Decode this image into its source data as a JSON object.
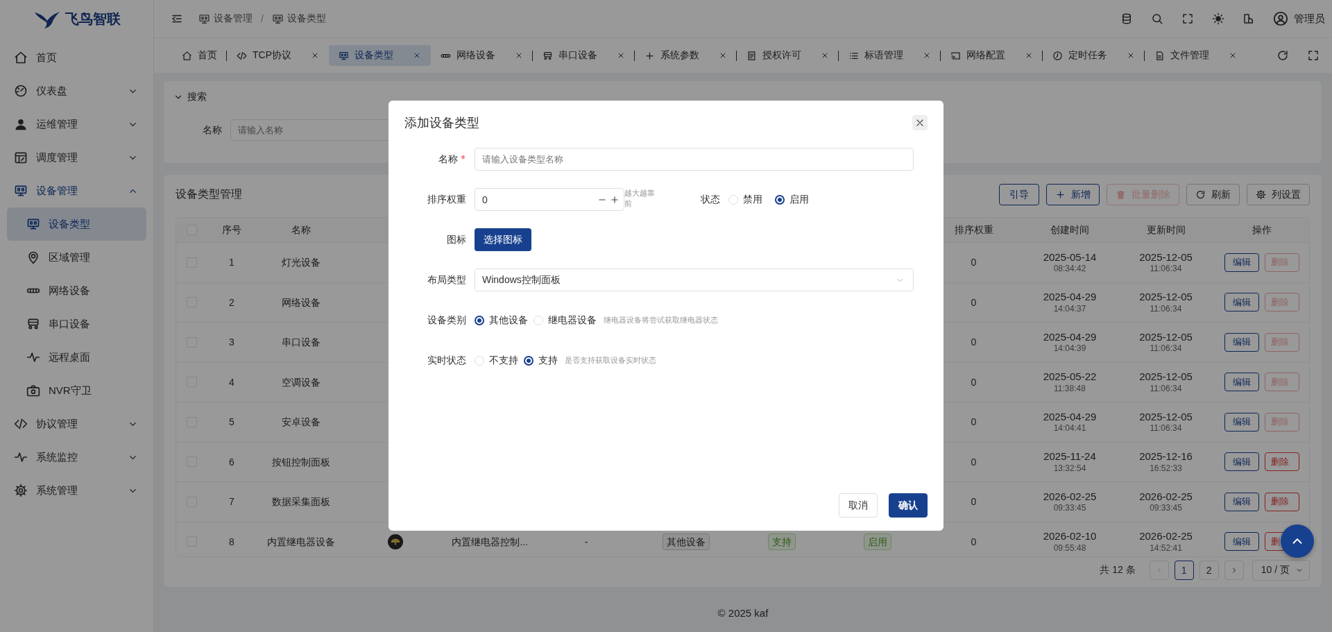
{
  "sidebar": {
    "logo": "飞鸟智联",
    "items": [
      {
        "label": "首页",
        "kind": "link",
        "selected": false
      },
      {
        "label": "仪表盘",
        "kind": "group",
        "expanded": false,
        "selected": false
      },
      {
        "label": "运维管理",
        "kind": "group",
        "expanded": false,
        "selected": false
      },
      {
        "label": "调度管理",
        "kind": "group",
        "expanded": false,
        "selected": false
      },
      {
        "label": "设备管理",
        "kind": "group",
        "expanded": true,
        "selected": true,
        "children": [
          {
            "label": "设备类型",
            "selected": true
          },
          {
            "label": "区域管理",
            "selected": false
          },
          {
            "label": "网络设备",
            "selected": false
          },
          {
            "label": "串口设备",
            "selected": false
          },
          {
            "label": "远程桌面",
            "selected": false
          },
          {
            "label": "NVR守卫",
            "selected": false
          }
        ]
      },
      {
        "label": "协议管理",
        "kind": "group",
        "expanded": false,
        "selected": false
      },
      {
        "label": "系统监控",
        "kind": "group",
        "expanded": false,
        "selected": false
      },
      {
        "label": "系统管理",
        "kind": "group",
        "expanded": false,
        "selected": false
      }
    ]
  },
  "header": {
    "breadcrumb": {
      "separator": "/",
      "items": [
        "设备管理",
        "设备类型"
      ]
    },
    "user": "管理员"
  },
  "tabs": [
    {
      "label": "首页",
      "selected": false,
      "closable": false
    },
    {
      "label": "TCP协议",
      "selected": false,
      "closable": true
    },
    {
      "label": "设备类型",
      "selected": true,
      "closable": true
    },
    {
      "label": "网络设备",
      "selected": false,
      "closable": true
    },
    {
      "label": "串口设备",
      "selected": false,
      "closable": true
    },
    {
      "label": "系统参数",
      "selected": false,
      "closable": true
    },
    {
      "label": "授权许可",
      "selected": false,
      "closable": true
    },
    {
      "label": "标语管理",
      "selected": false,
      "closable": true
    },
    {
      "label": "网络配置",
      "selected": false,
      "closable": true
    },
    {
      "label": "定时任务",
      "selected": false,
      "closable": true
    },
    {
      "label": "文件管理",
      "selected": false,
      "closable": true
    }
  ],
  "search": {
    "title": "搜索",
    "expanded": true,
    "fields": [
      {
        "label": "名称",
        "placeholder": "请输入名称"
      }
    ]
  },
  "table_panel": {
    "title": "设备类型管理",
    "toolbar": [
      {
        "label": "引导",
        "kind": "guide",
        "disabled": false
      },
      {
        "label": "新增",
        "kind": "add",
        "disabled": false
      },
      {
        "label": "批量删除",
        "kind": "delete",
        "disabled": true
      },
      {
        "label": "刷新",
        "kind": "refresh",
        "disabled": false
      },
      {
        "label": "列设置",
        "kind": "settings",
        "disabled": false
      }
    ],
    "header_checked": false,
    "columns": [
      "序号",
      "名称",
      "排序权重",
      "创建时间",
      "更新时间",
      "操作"
    ],
    "rows": [
      {
        "checked": false,
        "index": "1",
        "name": "灯光设备",
        "weight": "0",
        "created": [
          "2025-05-14",
          "08:34:42"
        ],
        "updated": [
          "2025-12-05",
          "11:06:34"
        ],
        "actions": [
          {
            "label": "编辑",
            "kind": "edit",
            "disabled": false
          },
          {
            "label": "删除",
            "kind": "delete",
            "disabled": true
          }
        ]
      },
      {
        "checked": false,
        "index": "2",
        "name": "网络设备",
        "weight": "0",
        "created": [
          "2025-04-29",
          "14:04:37"
        ],
        "updated": [
          "2025-12-05",
          "11:06:34"
        ],
        "actions": [
          {
            "label": "编辑",
            "kind": "edit",
            "disabled": false
          },
          {
            "label": "删除",
            "kind": "delete",
            "disabled": true
          }
        ]
      },
      {
        "checked": false,
        "index": "3",
        "name": "串口设备",
        "weight": "0",
        "created": [
          "2025-04-29",
          "14:04:39"
        ],
        "updated": [
          "2025-12-05",
          "11:06:34"
        ],
        "actions": [
          {
            "label": "编辑",
            "kind": "edit",
            "disabled": false
          },
          {
            "label": "删除",
            "kind": "delete",
            "disabled": true
          }
        ]
      },
      {
        "checked": false,
        "index": "4",
        "name": "空调设备",
        "weight": "0",
        "created": [
          "2025-05-22",
          "11:38:48"
        ],
        "updated": [
          "2025-12-05",
          "11:06:34"
        ],
        "actions": [
          {
            "label": "编辑",
            "kind": "edit",
            "disabled": false
          },
          {
            "label": "删除",
            "kind": "delete",
            "disabled": true
          }
        ]
      },
      {
        "checked": false,
        "index": "5",
        "name": "安卓设备",
        "weight": "0",
        "created": [
          "2025-04-29",
          "14:04:41"
        ],
        "updated": [
          "2025-12-05",
          "11:06:34"
        ],
        "actions": [
          {
            "label": "编辑",
            "kind": "edit",
            "disabled": false
          },
          {
            "label": "删除",
            "kind": "delete",
            "disabled": true
          }
        ]
      },
      {
        "checked": false,
        "index": "6",
        "name": "按钮控制面板",
        "weight": "0",
        "created": [
          "2025-11-24",
          "13:32:54"
        ],
        "updated": [
          "2025-12-16",
          "16:52:33"
        ],
        "actions": [
          {
            "label": "编辑",
            "kind": "edit",
            "disabled": false
          },
          {
            "label": "删除",
            "kind": "delete",
            "disabled": false
          }
        ]
      },
      {
        "checked": false,
        "index": "7",
        "name": "数据采集面板",
        "weight": "0",
        "created": [
          "2026-02-25",
          "09:33:45"
        ],
        "updated": [
          "2026-02-25",
          "09:33:45"
        ],
        "actions": [
          {
            "label": "编辑",
            "kind": "edit",
            "disabled": false
          },
          {
            "label": "删除",
            "kind": "delete",
            "disabled": false
          }
        ]
      },
      {
        "checked": false,
        "index": "8",
        "name": "内置继电器设备",
        "weight": "0",
        "created": [
          "2026-02-10",
          "09:55:48"
        ],
        "updated": [
          "2026-02-25",
          "14:52:41"
        ],
        "actions": [
          {
            "label": "编辑",
            "kind": "edit",
            "disabled": false
          },
          {
            "label": "删",
            "kind": "delete",
            "disabled": false
          }
        ],
        "extra": [
          {
            "kind": "icon"
          },
          {
            "kind": "text",
            "text": "内置继电器控制..."
          },
          {
            "kind": "text",
            "text": "-"
          },
          {
            "kind": "tag",
            "text": "其他设备"
          },
          {
            "kind": "status",
            "text": "支持"
          },
          {
            "kind": "status",
            "text": "启用"
          }
        ]
      }
    ],
    "pagination": {
      "total": "共 12 条",
      "pages": [
        {
          "label": "1",
          "selected": true
        },
        {
          "label": "2",
          "selected": false
        }
      ],
      "page_size": "10 / 页"
    }
  },
  "footer": {
    "text": "© 2025 kaf"
  },
  "dialog": {
    "title": "添加设备类型",
    "fields": [
      {
        "kind": "text",
        "label": "名称",
        "required": true,
        "placeholder": "请输入设备类型名称"
      },
      {
        "kind": "number",
        "label": "排序权重",
        "value": "0",
        "hint": "越大越靠前",
        "extra": {
          "label": "状态",
          "options": [
            {
              "label": "禁用",
              "selected": false
            },
            {
              "label": "启用",
              "selected": true
            }
          ]
        }
      },
      {
        "kind": "button",
        "label": "图标",
        "button": "选择图标"
      },
      {
        "kind": "select",
        "label": "布局类型",
        "value": "Windows控制面板"
      },
      {
        "kind": "radio",
        "label": "设备类别",
        "options": [
          {
            "label": "其他设备",
            "selected": true
          },
          {
            "label": "继电器设备",
            "selected": false
          }
        ],
        "hint": "继电器设备将尝试获取继电器状态"
      },
      {
        "kind": "radio",
        "label": "实时状态",
        "options": [
          {
            "label": "不支持",
            "selected": false
          },
          {
            "label": "支持",
            "selected": true
          }
        ],
        "hint": "是否支持获取设备实时状态"
      }
    ],
    "buttons": [
      {
        "label": "取消",
        "primary": false
      },
      {
        "label": "确认",
        "primary": true
      }
    ]
  }
}
